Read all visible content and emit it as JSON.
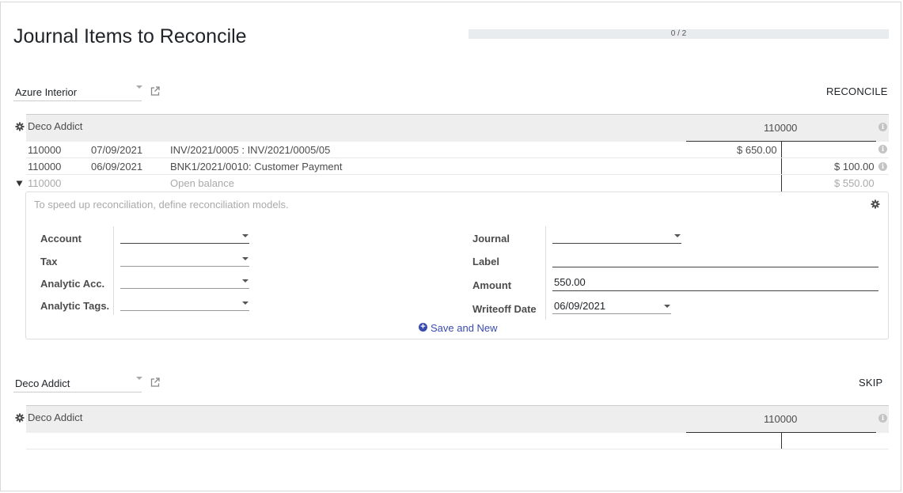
{
  "page": {
    "title": "Journal Items to Reconcile",
    "progress": {
      "text": "0 / 2",
      "fraction": 0
    }
  },
  "blocks": [
    {
      "partner": "Azure Interior",
      "action": "RECONCILE",
      "header": {
        "name": "Deco Addict",
        "account": "110000"
      },
      "lines": [
        {
          "account": "110000",
          "date": "07/09/2021",
          "label": "INV/2021/0005 : INV/2021/0005/05",
          "debit": "$ 650.00",
          "credit": ""
        },
        {
          "account": "110000",
          "date": "06/09/2021",
          "label": "BNK1/2021/0010: Customer Payment",
          "debit": "",
          "credit": "$ 100.00"
        }
      ],
      "open_balance": {
        "account": "110000",
        "label": "Open balance",
        "amount": "$ 550.00"
      },
      "form": {
        "hint": "To speed up reconciliation, define reconciliation models.",
        "account_label": "Account",
        "tax_label": "Tax",
        "analytic_acc_label": "Analytic Acc.",
        "analytic_tags_label": "Analytic Tags.",
        "journal_label": "Journal",
        "label_label": "Label",
        "amount_label": "Amount",
        "amount_value": "550.00",
        "writeoff_label": "Writeoff Date",
        "writeoff_value": "06/09/2021",
        "save_new": "Save and New"
      }
    },
    {
      "partner": "Deco Addict",
      "action": "SKIP",
      "header": {
        "name": "Deco Addict",
        "account": "110000"
      }
    }
  ],
  "icons": {
    "external_link": "external-link-icon",
    "gear": "gear-icon",
    "info": "info-icon",
    "caret": "caret-down-icon",
    "plus": "plus-circle-icon",
    "triangle": "triangle-down-icon"
  },
  "colors": {
    "accent": "#3a4bb0",
    "band": "#eeeeee",
    "progress_bg": "#e9ecef"
  }
}
